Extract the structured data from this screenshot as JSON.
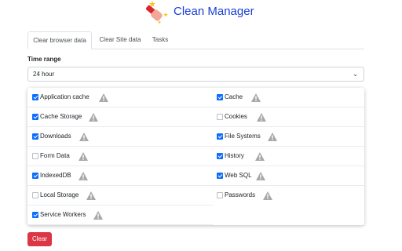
{
  "app": {
    "title": "Clean Manager",
    "logo_icon": "broom-icon"
  },
  "tabs": [
    {
      "label": "Clear browser data",
      "active": true
    },
    {
      "label": "Clear Site data",
      "active": false
    },
    {
      "label": "Tasks",
      "active": false
    }
  ],
  "time_range": {
    "label": "Time range",
    "value": "24 hour"
  },
  "data_types": {
    "left": [
      {
        "label": "Application cache",
        "checked": true
      },
      {
        "label": "Cache Storage",
        "checked": true
      },
      {
        "label": "Downloads",
        "checked": true
      },
      {
        "label": "Form Data",
        "checked": false
      },
      {
        "label": "IndexedDB",
        "checked": true
      },
      {
        "label": "Local Storage",
        "checked": false
      },
      {
        "label": "Service Workers",
        "checked": true
      }
    ],
    "right": [
      {
        "label": "Cache",
        "checked": true
      },
      {
        "label": "Cookies",
        "checked": false
      },
      {
        "label": "File Systems",
        "checked": true
      },
      {
        "label": "History",
        "checked": true
      },
      {
        "label": "Web SQL",
        "checked": true
      },
      {
        "label": "Passwords",
        "checked": false
      }
    ]
  },
  "actions": {
    "clear_label": "Clear"
  },
  "colors": {
    "accent": "#0d6efd",
    "title": "#1a3fd6",
    "danger": "#dc3545",
    "warning_icon": "#a8a8a8"
  }
}
